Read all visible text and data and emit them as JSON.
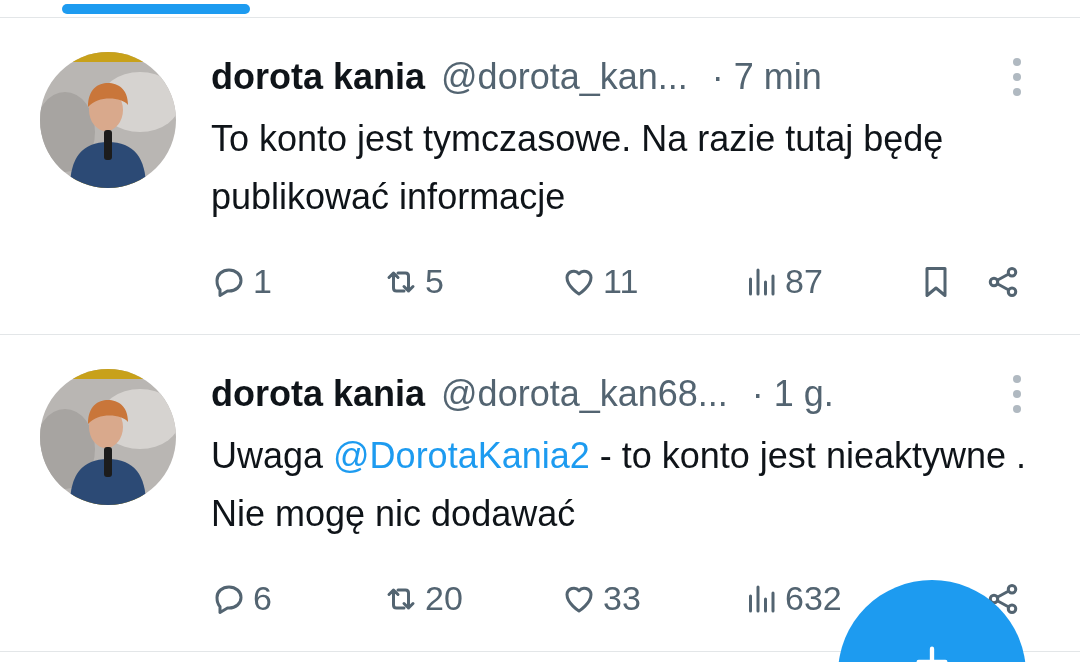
{
  "tab_indicator": {
    "selected": true
  },
  "tweets": [
    {
      "name": "dorota kania",
      "handle": "@dorota_kan...",
      "time": "· 7 min",
      "text": [
        {
          "kind": "text",
          "value": "To konto jest tymczasowe. Na razie tutaj będę publikować informacje"
        }
      ],
      "actions": [
        {
          "kind": "reply",
          "count": "1"
        },
        {
          "kind": "repost",
          "count": "5"
        },
        {
          "kind": "like",
          "count": "11"
        },
        {
          "kind": "views",
          "count": "87"
        },
        {
          "kind": "bookmark"
        },
        {
          "kind": "share"
        }
      ]
    },
    {
      "name": "dorota kania",
      "handle": "@dorota_kan68...",
      "time": "· 1 g.",
      "text": [
        {
          "kind": "text",
          "value": "Uwaga "
        },
        {
          "kind": "mention",
          "value": "@DorotaKania2"
        },
        {
          "kind": "text",
          "value": " - to konto jest nieaktywne . Nie mogę nic dodawać"
        }
      ],
      "actions": [
        {
          "kind": "reply",
          "count": "6"
        },
        {
          "kind": "repost",
          "count": "20"
        },
        {
          "kind": "like",
          "count": "33"
        },
        {
          "kind": "views",
          "count": "632"
        },
        {
          "kind": "share"
        }
      ]
    }
  ],
  "compose_button": {
    "kind": "fab"
  }
}
